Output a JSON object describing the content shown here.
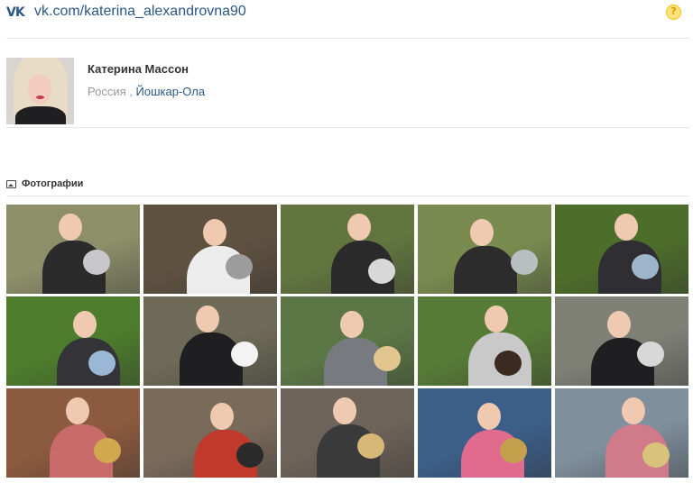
{
  "header": {
    "url": "vk.com/katerina_alexandrovna90"
  },
  "profile": {
    "name": "Катерина Массон",
    "country": "Россия",
    "separator": ",",
    "city": "Йошкар-Ола"
  },
  "photos_section": {
    "title": "Фотографии",
    "photos": [
      {
        "bg": "#8d8f6a",
        "accent": "#2b2b2b",
        "accent2": "#c7c7cc"
      },
      {
        "bg": "#5e5140",
        "accent": "#ececec",
        "accent2": "#9c9c9c"
      },
      {
        "bg": "#62753f",
        "accent": "#2a2a2a",
        "accent2": "#d8d8d8"
      },
      {
        "bg": "#7a8b4f",
        "accent": "#2c2c2c",
        "accent2": "#b9bec0"
      },
      {
        "bg": "#4d6d2a",
        "accent": "#2f2f33",
        "accent2": "#9eb6cc"
      },
      {
        "bg": "#4d7d2c",
        "accent": "#333338",
        "accent2": "#9ab8d6"
      },
      {
        "bg": "#6d6a57",
        "accent": "#1f1f22",
        "accent2": "#f3f3f3"
      },
      {
        "bg": "#5c7746",
        "accent": "#777b7f",
        "accent2": "#e3c58f"
      },
      {
        "bg": "#567b36",
        "accent": "#c9c9c9",
        "accent2": "#3a2a20"
      },
      {
        "bg": "#7f8177",
        "accent": "#1f1f22",
        "accent2": "#d8d8d8"
      },
      {
        "bg": "#8c5a3e",
        "accent": "#c96b6b",
        "accent2": "#d3a74c"
      },
      {
        "bg": "#7a6a5a",
        "accent": "#c0392b",
        "accent2": "#2b2b2b"
      },
      {
        "bg": "#6d6359",
        "accent": "#3a3a3a",
        "accent2": "#d8b877"
      },
      {
        "bg": "#3c5f8a",
        "accent": "#e06b8f",
        "accent2": "#c4a04c"
      },
      {
        "bg": "#7f8f9c",
        "accent": "#d07a8a",
        "accent2": "#d9c27a"
      }
    ]
  }
}
